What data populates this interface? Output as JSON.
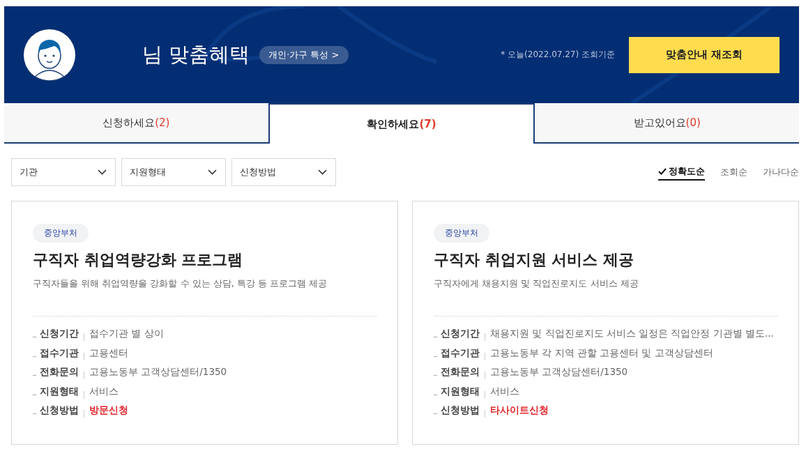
{
  "header": {
    "title": "님 맞춤혜택",
    "profile_link": "개인·가구 특성 >",
    "date_note": "* 오늘(2022.07.27) 조회기준",
    "refresh_button": "맞춤안내 재조회"
  },
  "tabs": [
    {
      "label": "신청하세요",
      "count": "(2)",
      "selected": false
    },
    {
      "label": "확인하세요",
      "count": "(7)",
      "selected": true
    },
    {
      "label": "받고있어요",
      "count": "(0)",
      "selected": false
    }
  ],
  "filters": [
    {
      "label": "기관"
    },
    {
      "label": "지원형태"
    },
    {
      "label": "신청방법"
    }
  ],
  "sort_options": [
    {
      "label": "정확도순",
      "selected": true
    },
    {
      "label": "조회순",
      "selected": false
    },
    {
      "label": "가나다순",
      "selected": false
    }
  ],
  "cards": [
    {
      "tag": "중앙부처",
      "title": "구직자 취업역량강화 프로그램",
      "description": "구직자들을 위해 취업역량을 강화할 수 있는 상담, 특강 등 프로그램 제공",
      "details": [
        {
          "label": "신청기간",
          "value": "접수기관 별 상이",
          "highlighted": false
        },
        {
          "label": "접수기관",
          "value": "고용센터",
          "highlighted": false
        },
        {
          "label": "전화문의",
          "value": "고용노동부 고객상담센터/1350",
          "highlighted": false
        },
        {
          "label": "지원형태",
          "value": "서비스",
          "highlighted": false
        },
        {
          "label": "신청방법",
          "value": "방문신청",
          "highlighted": true
        }
      ]
    },
    {
      "tag": "중앙부처",
      "title": "구직자 취업지원 서비스 제공",
      "description": "구직자에게 채용지원 및 직업진로지도 서비스 제공",
      "details": [
        {
          "label": "신청기간",
          "value": "채용지원 및 직업진로지도 서비스 일정은 직업안정 기관별 별도...",
          "highlighted": false
        },
        {
          "label": "접수기관",
          "value": "고용노동부 각 지역 관할 고용센터 및 고객상담센터",
          "highlighted": false
        },
        {
          "label": "전화문의",
          "value": "고용노동부 고객상담센터/1350",
          "highlighted": false
        },
        {
          "label": "지원형태",
          "value": "서비스",
          "highlighted": false
        },
        {
          "label": "신청방법",
          "value": "타사이트신청",
          "highlighted": true
        }
      ]
    }
  ]
}
